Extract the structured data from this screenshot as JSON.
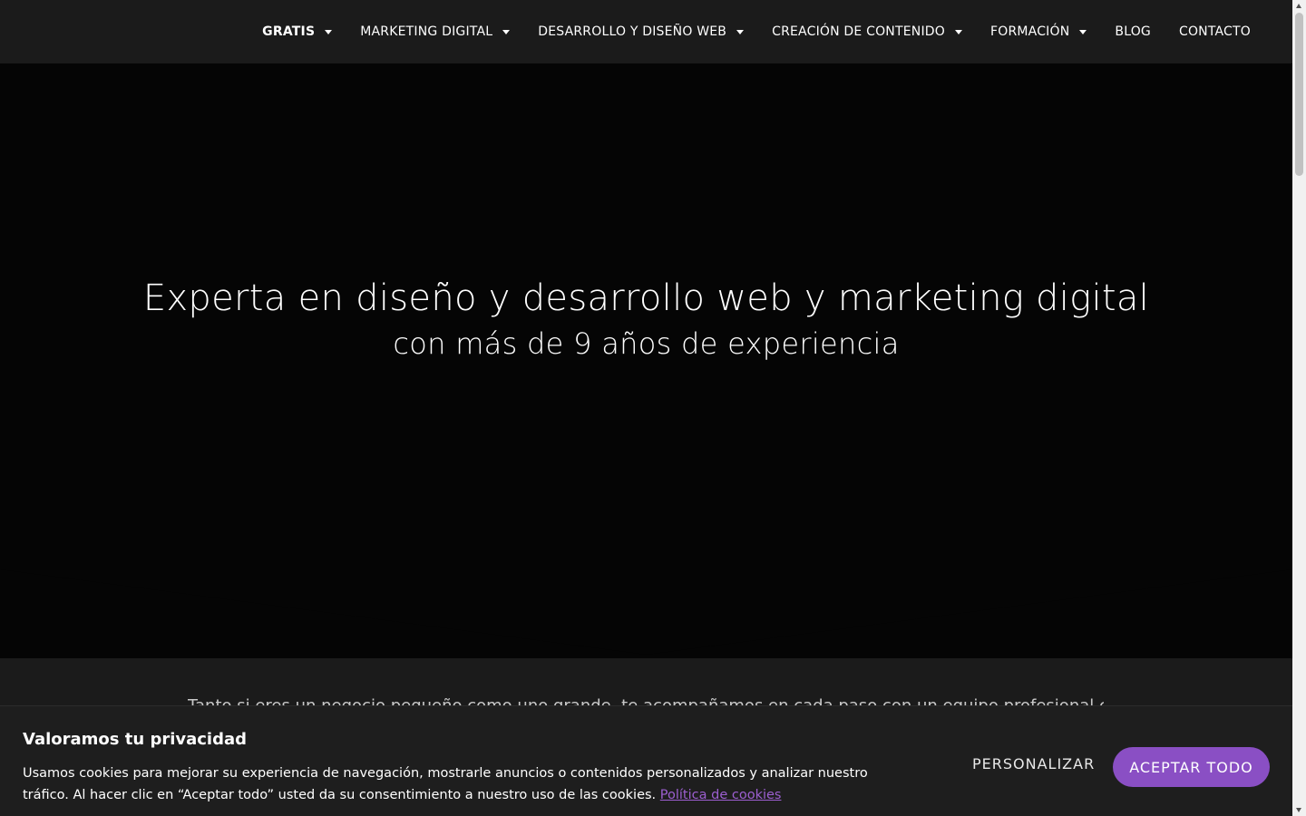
{
  "nav": {
    "items": [
      {
        "label": "GRATIS",
        "has_dropdown": true,
        "active": true
      },
      {
        "label": "MARKETING DIGITAL",
        "has_dropdown": true
      },
      {
        "label": "DESARROLLO Y DISEÑO WEB",
        "has_dropdown": true
      },
      {
        "label": "CREACIÓN DE CONTENIDO",
        "has_dropdown": true
      },
      {
        "label": "FORMACIÓN",
        "has_dropdown": true
      },
      {
        "label": "BLOG",
        "has_dropdown": false
      },
      {
        "label": "CONTACTO",
        "has_dropdown": false
      }
    ],
    "dropdown_icon": "caret-down-icon"
  },
  "hero": {
    "title": "Experta en diseño y desarrollo web y marketing digital",
    "subtitle": "con más de 9 años de experiencia"
  },
  "section": {
    "peek_text": "Tanto si eres un negocio pequeño como uno grande, te acompañamos en cada paso con un equipo profesional cercano."
  },
  "cookie_banner": {
    "title": "Valoramos tu privacidad",
    "text": "Usamos cookies para mejorar su experiencia de navegación, mostrarle anuncios o contenidos personalizados y analizar nuestro tráfico. Al hacer clic en “Aceptar todo” usted da su consentimiento a nuestro uso de las cookies.",
    "policy_link": "Política de cookies",
    "customize_label": "PERSONALIZAR",
    "accept_label": "ACEPTAR TODO"
  },
  "colors": {
    "header_bg": "#1b1b1b",
    "hero_bg": "#050505",
    "accent": "#8a4fc4",
    "link": "#9c5fd0"
  }
}
